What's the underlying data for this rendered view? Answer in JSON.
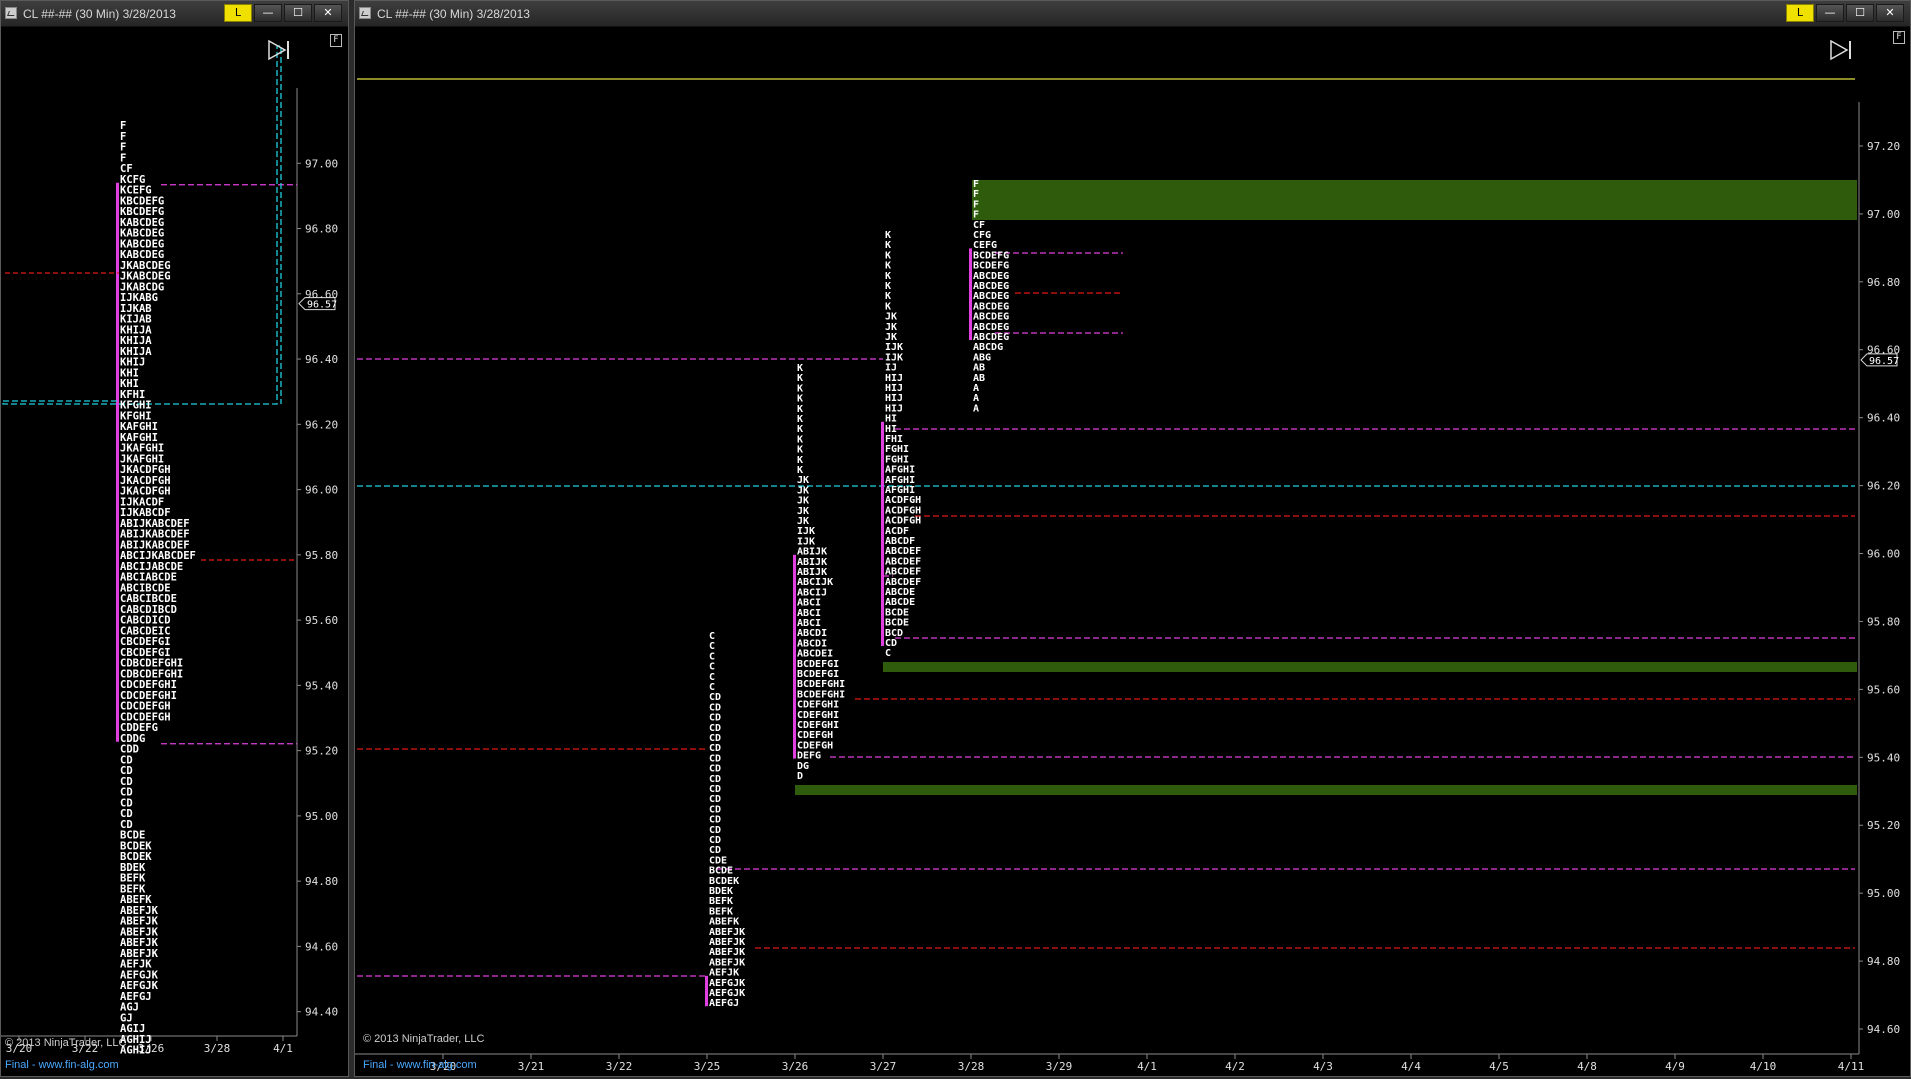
{
  "left_window": {
    "title": "CL ##-## (30 Min)  3/28/2013",
    "buttons": {
      "link": "L",
      "minimize": "—",
      "maximize": "☐",
      "close": "✕"
    },
    "copyright": "© 2013 NinjaTrader, LLC",
    "final_text": "Final - www.fin-alg.com",
    "f_label": "F",
    "current_price": "96.57",
    "price_ticks": [
      "97.00",
      "96.80",
      "96.60",
      "96.40",
      "96.20",
      "96.00",
      "95.80",
      "95.60",
      "95.40",
      "95.20",
      "95.00",
      "94.80",
      "94.60",
      "94.40"
    ],
    "date_ticks": [
      "3/20",
      "3/22",
      "3/26",
      "3/28",
      "4/1"
    ]
  },
  "right_window": {
    "title": "CL ##-## (30 Min)  3/28/2013",
    "buttons": {
      "link": "L",
      "minimize": "—",
      "maximize": "☐",
      "close": "✕"
    },
    "copyright": "© 2013 NinjaTrader, LLC",
    "final_text": "Final - www.fin-alg.com",
    "f_label": "F",
    "current_price": "96.57",
    "price_ticks": [
      "97.20",
      "97.00",
      "96.80",
      "96.60",
      "96.40",
      "96.20",
      "96.00",
      "95.80",
      "95.60",
      "95.40",
      "95.20",
      "95.00",
      "94.80",
      "94.60"
    ],
    "date_ticks": [
      "3/20",
      "3/21",
      "3/22",
      "3/25",
      "3/26",
      "3/27",
      "3/28",
      "3/29",
      "4/1",
      "4/2",
      "4/3",
      "4/4",
      "4/5",
      "4/8",
      "4/9",
      "4/10",
      "4/11"
    ]
  },
  "colors": {
    "value_area": "#e040e0",
    "poc": "#e01818",
    "cyan_level": "#20d0e0",
    "yellow_level": "#e0e040",
    "gap_zone": "#2e5c0c",
    "tpo_text": "#ffffff"
  },
  "chart_data": [
    {
      "type": "market-profile",
      "title": "CL ##-## (30 Min) 3/28/2013 — composite",
      "ylim": [
        94.35,
        97.2
      ],
      "x_ticks": [
        "3/20",
        "3/22",
        "3/26",
        "3/28",
        "4/1"
      ],
      "profiles": [
        {
          "session": "composite",
          "top_price": 97.05,
          "tick": 0.03,
          "rows": [
            "F",
            "F",
            "F",
            "F",
            "CF",
            "KCFG",
            "KCEFG",
            "KBCDEFG",
            "KBCDEFG",
            "KABCDEG",
            "KABCDEG",
            "KABCDEG",
            "KABCDEG",
            "JKABCDEG",
            "JKABCDEG",
            "JKABCDG",
            "IJKABG",
            "IJKAB",
            "KIJAB",
            "KHIJA",
            "KHIJA",
            "KHIJA",
            "KHIJ",
            "KHI",
            "KHI",
            "KFHI",
            "KFGHI",
            "KFGHI",
            "KAFGHI",
            "KAFGHI",
            "JKAFGHI",
            "JKAFGHI",
            "JKACDFGH",
            "JKACDFGH",
            "JKACDFGH",
            "IJKACDF",
            "IJKABCDF",
            "ABIJKABCDEF",
            "ABIJKABCDEF",
            "ABIJKABCDEF",
            "ABCIJKABCDEF",
            "ABCIJABCDE",
            "ABCIABCDE",
            "ABCIBCDE",
            "CABCIBCDE",
            "CABCDIBCD",
            "CABCDICD",
            "CABCDEIC",
            "CBCDEFGI",
            "CBCDEFGI",
            "CDBCDEFGHI",
            "CDBCDEFGHI",
            "CDCDEFGHI",
            "CDCDEFGHI",
            "CDCDEFGH",
            "CDCDEFGH",
            "CDDEFG",
            "CDDG",
            "CDD",
            "CD",
            "CD",
            "CD",
            "CD",
            "CD",
            "CD",
            "CD",
            "BCDE",
            "BCDEK",
            "BCDEK",
            "BDEK",
            "BEFK",
            "BEFK",
            "ABEFK",
            "ABEFJK",
            "ABEFJK",
            "ABEFJK",
            "ABEFJK",
            "ABEFJK",
            "AEFJK",
            "AEFGJK",
            "AEFGJK",
            "AEFGJ",
            "AGJ",
            "GJ",
            "AGIJ",
            "AGHIJ",
            "AGHIJ"
          ],
          "value_area_high": 96.81,
          "value_area_low": 95.24,
          "poc": 95.79
        }
      ],
      "levels": {
        "cyan": 96.15,
        "prior_poc": 96.52
      }
    },
    {
      "type": "market-profile",
      "title": "CL ##-## (30 Min) 3/28/2013 — daily",
      "ylim": [
        94.55,
        97.3
      ],
      "x_ticks": [
        "3/20",
        "3/21",
        "3/22",
        "3/25",
        "3/26",
        "3/27",
        "3/28",
        "3/29",
        "4/1",
        "4/2",
        "4/3",
        "4/4",
        "4/5",
        "4/8",
        "4/9",
        "4/10",
        "4/11"
      ],
      "profiles": [
        {
          "session": "3/25",
          "top_price": 95.45,
          "tick": 0.03,
          "rows": [
            "C",
            "C",
            "C",
            "C",
            "C",
            "C",
            "CD",
            "CD",
            "CD",
            "CD",
            "CD",
            "CD",
            "CD",
            "CD",
            "CD",
            "CD",
            "CD",
            "CD",
            "CD",
            "CD",
            "CD",
            "CD",
            "CDE",
            "BCDE",
            "BCDEK",
            "BDEK",
            "BEFK",
            "BEFK",
            "ABEFK",
            "ABEFJK",
            "ABEFJK",
            "ABEFJK",
            "ABEFJK",
            "AEFJK",
            "AEFGJK",
            "AEFGJK",
            "AEFGJ"
          ],
          "value_area_high": 95.0,
          "value_area_low": 94.52,
          "poc": 94.75
        },
        {
          "session": "3/26",
          "top_price": 96.25,
          "tick": 0.03,
          "rows": [
            "K",
            "K",
            "K",
            "K",
            "K",
            "K",
            "K",
            "K",
            "K",
            "K",
            "K",
            "JK",
            "JK",
            "JK",
            "JK",
            "JK",
            "IJK",
            "IJK",
            "ABIJK",
            "ABIJK",
            "ABIJK",
            "ABCIJK",
            "ABCIJ",
            "ABCI",
            "ABCI",
            "ABCI",
            "ABCDI",
            "ABCDI",
            "ABCDEI",
            "BCDEFGI",
            "BCDEFGI",
            "BCDEFGHI",
            "BCDEFGHI",
            "CDEFGHI",
            "CDEFGHI",
            "CDEFGHI",
            "CDEFGH",
            "CDEFGH",
            "DEFG",
            "DG",
            "D"
          ],
          "value_area_high": 95.75,
          "value_area_low": 95.32,
          "poc": 95.5
        },
        {
          "session": "3/27",
          "top_price": 96.75,
          "tick": 0.03,
          "rows": [
            "K",
            "K",
            "K",
            "K",
            "K",
            "K",
            "K",
            "K",
            "JK",
            "JK",
            "JK",
            "IJK",
            "IJK",
            "IJ",
            "HIJ",
            "HIJ",
            "HIJ",
            "HIJ",
            "HI",
            "HI",
            "FHI",
            "FGHI",
            "FGHI",
            "AFGHI",
            "AFGHI",
            "AFGHI",
            "ACDFGH",
            "ACDFGH",
            "ACDFGH",
            "ACDF",
            "ABCDF",
            "ABCDEF",
            "ABCDEF",
            "ABCDEF",
            "ABCDEF",
            "ABCDE",
            "ABCDE",
            "BCDE",
            "BCDE",
            "BCD",
            "CD",
            "C"
          ],
          "value_area_high": 96.27,
          "value_area_low": 95.67,
          "poc": 96.03
        },
        {
          "session": "3/28",
          "top_price": 97.0,
          "tick": 0.03,
          "rows": [
            "F",
            "F",
            "F",
            "F",
            "CF",
            "CFG",
            "CEFG",
            "BCDEFG",
            "BCDEFG",
            "ABCDEG",
            "ABCDEG",
            "ABCDEG",
            "ABCDEG",
            "ABCDEG",
            "ABCDEG",
            "ABCDEG",
            "ABCDG",
            "ABG",
            "AB",
            "AB",
            "A",
            "A",
            "A"
          ],
          "value_area_high": 96.78,
          "value_area_low": 96.53,
          "poc": 96.66
        }
      ],
      "gap_zones": [
        {
          "from": 96.88,
          "to": 96.99
        },
        {
          "from": 95.58,
          "to": 95.61
        },
        {
          "from": 95.21,
          "to": 95.24
        }
      ],
      "levels": {
        "yellow": 97.1,
        "cyan": 96.11,
        "poc_3_25": 95.17,
        "magenta_3_22": 96.27,
        "magenta_3_20": 94.52
      }
    }
  ]
}
